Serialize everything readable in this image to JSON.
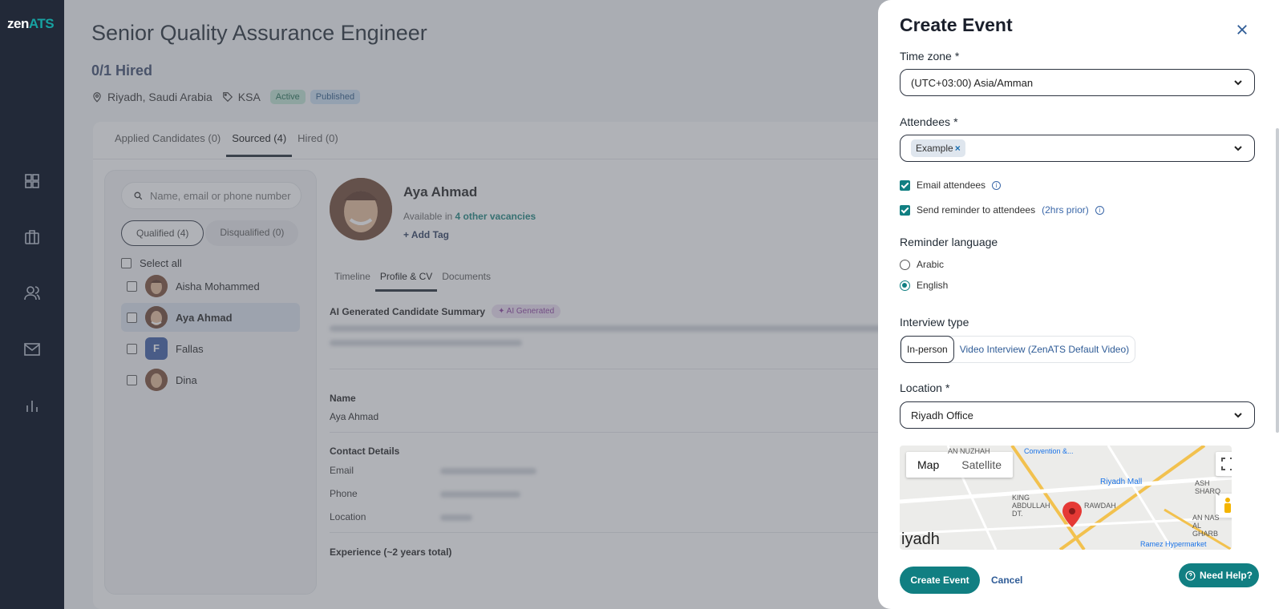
{
  "app": {
    "logo_main": "zen",
    "logo_accent": "ATS"
  },
  "job": {
    "title": "Senior Quality Assurance Engineer",
    "hired": "0/1 Hired",
    "location": "Riyadh, Saudi Arabia",
    "tag": "KSA",
    "status_badge": "Active",
    "publish_badge": "Published"
  },
  "tabs": [
    "Applied Candidates (0)",
    "Sourced (4)",
    "Hired (0)"
  ],
  "candidates_panel": {
    "search_placeholder": "Name, email or phone number",
    "qualified": "Qualified (4)",
    "disqualified": "Disqualified (0)",
    "select_all": "Select all",
    "candidates": [
      {
        "name": "Aisha Mohammed",
        "initial": ""
      },
      {
        "name": "Aya Ahmad",
        "initial": ""
      },
      {
        "name": "Fallas",
        "initial": "F"
      },
      {
        "name": "Dina",
        "initial": ""
      }
    ]
  },
  "profile": {
    "name": "Aya Ahmad",
    "available_prefix": "Available in ",
    "available_link": "4 other vacancies",
    "add_tag": "Add Tag",
    "tabs": [
      "Timeline",
      "Profile & CV",
      "Documents"
    ],
    "ai_summary_title": "AI Generated Candidate Summary",
    "ai_badge": "AI Generated",
    "name_label": "Name",
    "name_value": "Aya Ahmad",
    "contact_title": "Contact Details",
    "email_label": "Email",
    "phone_label": "Phone",
    "location_label": "Location",
    "experience_title": "Experience (~2 years total)"
  },
  "modal": {
    "title": "Create Event",
    "timezone_label": "Time zone",
    "timezone_value": "(UTC+03:00) Asia/Amman",
    "attendees_label": "Attendees",
    "attendee_chip": "Example",
    "email_attendees": "Email attendees",
    "send_reminder": "Send reminder to attendees",
    "reminder_note": "(2hrs prior)",
    "reminder_language_label": "Reminder language",
    "lang_options": [
      "Arabic",
      "English"
    ],
    "interview_type_label": "Interview type",
    "interview_types": [
      "In-person",
      "Video Interview (ZenATS Default Video)"
    ],
    "location_label": "Location",
    "location_value": "Riyadh Office",
    "map_tab_map": "Map",
    "map_tab_satellite": "Satellite",
    "map_city": "iyadh",
    "map_labels": [
      "AN NUZHAH",
      "Convention &...",
      "Riyadh Mall",
      "KING ABDULLAH DT.",
      "RAWDAH",
      "AN NAS AL GHARB",
      "ASH SHARQ",
      "Ramez Hypermarket"
    ],
    "required_mark": "*",
    "create_button": "Create Event",
    "cancel_button": "Cancel",
    "help_button": "Need Help?"
  },
  "colors": {
    "accent": "#117f82",
    "sidebar": "#222938"
  }
}
